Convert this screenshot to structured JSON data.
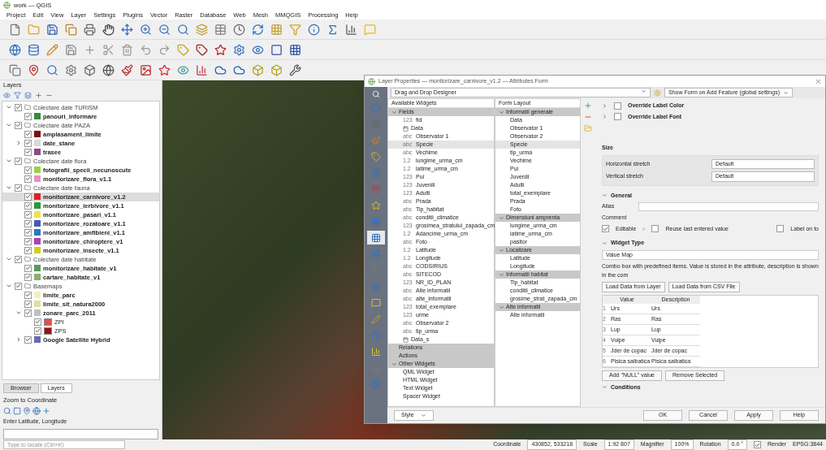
{
  "window": {
    "title": "work — QGIS"
  },
  "menu": [
    "Project",
    "Edit",
    "View",
    "Layer",
    "Settings",
    "Plugins",
    "Vector",
    "Raster",
    "Database",
    "Web",
    "Mesh",
    "MMQGIS",
    "Processing",
    "Help"
  ],
  "layers_panel": {
    "title": "Layers",
    "items": [
      {
        "kind": "group",
        "label": "Colectare date TURISM",
        "checked": true,
        "expanded": true,
        "children": [
          {
            "kind": "layer",
            "label": "panouri_informare",
            "checked": true,
            "color": "#3a8a3a"
          }
        ]
      },
      {
        "kind": "group",
        "label": "Colectare date PAZA",
        "checked": true,
        "expanded": true,
        "children": [
          {
            "kind": "layer",
            "label": "amplasament_limite",
            "checked": true,
            "color": "#7a1010"
          },
          {
            "kind": "layer",
            "label": "date_stane",
            "checked": true,
            "expanded": false,
            "color": "#d8d8d8"
          },
          {
            "kind": "layer",
            "label": "trasee",
            "checked": true,
            "color": "#8a4a8a"
          }
        ]
      },
      {
        "kind": "group",
        "label": "Colectare date flora",
        "checked": true,
        "expanded": true,
        "children": [
          {
            "kind": "layer",
            "label": "fotografii_specii_necunoscute",
            "checked": true,
            "color": "#9ad04a"
          },
          {
            "kind": "layer",
            "label": "monitorizare_flora_v1.1",
            "checked": true,
            "color": "#e890c8"
          }
        ]
      },
      {
        "kind": "group",
        "label": "Colectare date fauna",
        "checked": true,
        "expanded": true,
        "children": [
          {
            "kind": "layer",
            "label": "monitorizare_carnivore_v1.2",
            "checked": true,
            "selected": true,
            "color": "#e02020"
          },
          {
            "kind": "layer",
            "label": "monitorizare_ierbivore_v1.1",
            "checked": true,
            "color": "#2a9a3a"
          },
          {
            "kind": "layer",
            "label": "monitorizare_pasari_v1.1",
            "checked": true,
            "color": "#f0e050"
          },
          {
            "kind": "layer",
            "label": "monitorizare_rozatoare_v1.1",
            "checked": true,
            "color": "#4a5ab0"
          },
          {
            "kind": "layer",
            "label": "monitorizare_amfibieni_v1.1",
            "checked": true,
            "color": "#2a7ac0"
          },
          {
            "kind": "layer",
            "label": "monitorizare_chiroptere_v1",
            "checked": true,
            "color": "#b040b0"
          },
          {
            "kind": "layer",
            "label": "monitorizare_insecte_v1.1",
            "checked": true,
            "color": "#d0d020"
          }
        ]
      },
      {
        "kind": "group",
        "label": "Colectare date habitate",
        "checked": true,
        "expanded": true,
        "children": [
          {
            "kind": "layer",
            "label": "monitorizare_habitate_v1",
            "checked": true,
            "color": "#5a9a5a"
          },
          {
            "kind": "layer",
            "label": "cartare_habitate_v1",
            "checked": true,
            "color": "#8ab070"
          }
        ]
      },
      {
        "kind": "group",
        "label": "Basemaps",
        "checked": true,
        "expanded": true,
        "children": [
          {
            "kind": "layer",
            "label": "limite_parc",
            "checked": true,
            "color": "#f0f0c0"
          },
          {
            "kind": "layer",
            "label": "limite_sit_natura2000",
            "checked": true,
            "color": "#e0e0a0"
          },
          {
            "kind": "layer",
            "label": "zonare_parc_2011",
            "checked": true,
            "expanded": true,
            "color": "#c0c0c0",
            "children": [
              {
                "kind": "class",
                "label": "ZPI",
                "checked": true,
                "color": "#e05050"
              },
              {
                "kind": "class",
                "label": "ZPS",
                "checked": true,
                "color": "#a01010"
              }
            ]
          },
          {
            "kind": "layer",
            "label": "Google Satellite Hybrid",
            "checked": true,
            "expanded": false,
            "color": "#6a6ab0"
          }
        ]
      }
    ]
  },
  "bottom_tabs": [
    {
      "label": "Browser",
      "selected": false
    },
    {
      "label": "Layers",
      "selected": true
    }
  ],
  "zoom_panel": {
    "title": "Zoom to Coordinate",
    "prompt": "Enter Latitude, Longitude"
  },
  "dialog": {
    "title": "Layer Properties — monitorizare_carnivore_v1.2 — Attributes Form",
    "mode": "Drag and Drop Designer",
    "form_option": "Show Form on Add Feature (global settings)",
    "available": {
      "title": "Available Widgets",
      "groups": [
        {
          "label": "Fields",
          "expanded": true,
          "items": [
            {
              "kind": "field",
              "type": "123",
              "name": "fid",
              "selected": false
            },
            {
              "kind": "date",
              "name": "Data",
              "selected": false
            },
            {
              "kind": "field",
              "type": "abc",
              "name": "Observator 1",
              "selected": false
            },
            {
              "kind": "field",
              "type": "abc",
              "name": "Specie",
              "selected": true
            },
            {
              "kind": "field",
              "type": "abc",
              "name": "Vechime",
              "selected": false
            },
            {
              "kind": "field",
              "type": "1.2",
              "name": "lungime_urma_cm",
              "selected": false
            },
            {
              "kind": "field",
              "type": "1.2",
              "name": "latime_urma_cm",
              "selected": false
            },
            {
              "kind": "field",
              "type": "123",
              "name": "Pui",
              "selected": false
            },
            {
              "kind": "field",
              "type": "123",
              "name": "Juvenili",
              "selected": false
            },
            {
              "kind": "field",
              "type": "123",
              "name": "Adulti",
              "selected": false
            },
            {
              "kind": "field",
              "type": "abc",
              "name": "Prada",
              "selected": false
            },
            {
              "kind": "field",
              "type": "abc",
              "name": "Tip_habitat",
              "selected": false
            },
            {
              "kind": "field",
              "type": "abc",
              "name": "conditii_climatice",
              "selected": false
            },
            {
              "kind": "field",
              "type": "123",
              "name": "grosimea_stratului_zapada_cm",
              "selected": false
            },
            {
              "kind": "field",
              "type": "1.2",
              "name": "Adancime_urma_cm",
              "selected": false
            },
            {
              "kind": "field",
              "type": "abc",
              "name": "Foto",
              "selected": false
            },
            {
              "kind": "field",
              "type": "1.2",
              "name": "Latitude",
              "selected": false
            },
            {
              "kind": "field",
              "type": "1.2",
              "name": "Longitude",
              "selected": false
            },
            {
              "kind": "field",
              "type": "abc",
              "name": "CODSIRIUS",
              "selected": false
            },
            {
              "kind": "field",
              "type": "abc",
              "name": "SITECOD",
              "selected": false
            },
            {
              "kind": "field",
              "type": "123",
              "name": "NR_ID_PLAN",
              "selected": false
            },
            {
              "kind": "field",
              "type": "abc",
              "name": "Alte informatii",
              "selected": false
            },
            {
              "kind": "field",
              "type": "abc",
              "name": "alte_informatii",
              "selected": false
            },
            {
              "kind": "field",
              "type": "123",
              "name": "total_exemplare",
              "selected": false
            },
            {
              "kind": "field",
              "type": "123",
              "name": "urme",
              "selected": false
            },
            {
              "kind": "field",
              "type": "abc",
              "name": "Observator 2",
              "selected": false
            },
            {
              "kind": "field",
              "type": "abc",
              "name": "tip_urma",
              "selected": false
            },
            {
              "kind": "date",
              "name": "Data_s",
              "selected": false
            }
          ]
        },
        {
          "label": "Relations"
        },
        {
          "label": "Actions"
        },
        {
          "label": "Other Widgets",
          "expanded": true,
          "items": [
            {
              "kind": "other",
              "name": "QML Widget",
              "selected": false
            },
            {
              "kind": "other",
              "name": "HTML Widget",
              "selected": false
            },
            {
              "kind": "other",
              "name": "Text Widget",
              "selected": false
            },
            {
              "kind": "other",
              "name": "Spacer Widget",
              "selected": false
            }
          ]
        }
      ]
    },
    "layout": {
      "title": "Form Layout",
      "groups": [
        {
          "label": "Informatii generale",
          "items": [
            {
              "name": "Data",
              "selected": false
            },
            {
              "name": "Observator 1",
              "selected": false
            },
            {
              "name": "Observator 2",
              "selected": false
            },
            {
              "name": "Specie",
              "selected": true
            },
            {
              "name": "tip_urma",
              "selected": false
            },
            {
              "name": "Vechime",
              "selected": false
            },
            {
              "name": "Pui",
              "selected": false
            },
            {
              "name": "Juvenili",
              "selected": false
            },
            {
              "name": "Adulti",
              "selected": false
            },
            {
              "name": "total_exemplare",
              "selected": false
            },
            {
              "name": "Prada",
              "selected": false
            },
            {
              "name": "Foto",
              "selected": false
            }
          ]
        },
        {
          "label": "Dimensiuni amprenta",
          "items": [
            {
              "name": "lungime_urma_cm",
              "selected": false
            },
            {
              "name": "latime_urma_cm",
              "selected": false
            },
            {
              "name": "pasitor",
              "selected": false
            }
          ]
        },
        {
          "label": "Localizare",
          "items": [
            {
              "name": "Latitude",
              "selected": false
            },
            {
              "name": "Longitude",
              "selected": false
            }
          ]
        },
        {
          "label": "Informatii habitat",
          "items": [
            {
              "name": "Tip_habitat",
              "selected": false
            },
            {
              "name": "conditii_climatice",
              "selected": false
            },
            {
              "name": "grosime_strat_zapada_cm",
              "selected": false
            }
          ]
        },
        {
          "label": "Alte informatii",
          "items": [
            {
              "name": "Alte informatii",
              "selected": false
            }
          ]
        }
      ]
    },
    "config": {
      "overrides": [
        {
          "label": "Override Label Color",
          "checked": false
        },
        {
          "label": "Override Label Font",
          "checked": false
        }
      ],
      "size": {
        "title": "Size",
        "rows": [
          {
            "label": "Horizontal stretch",
            "value": "Default"
          },
          {
            "label": "Vertical stretch",
            "value": "Default"
          }
        ]
      },
      "general": {
        "title": "General",
        "alias_label": "Alias",
        "comment_label": "Comment",
        "options": [
          {
            "label": "Editable",
            "checked": true
          },
          {
            "label": "Reuse last entered value",
            "checked": false
          },
          {
            "label": "Label on to",
            "checked": false
          }
        ]
      },
      "widget_type": {
        "title": "Widget Type",
        "value": "Value Map",
        "description": "Combo box with predefined items. Value is stored in the attribute, description is shown in the com",
        "load_buttons": [
          "Load Data from Layer",
          "Load Data from CSV File"
        ],
        "columns": [
          "Value",
          "Description"
        ],
        "rows": [
          {
            "index": "1",
            "value": "Urs",
            "description": "Urs"
          },
          {
            "index": "2",
            "value": "Ras",
            "description": "Ras"
          },
          {
            "index": "3",
            "value": "Lup",
            "description": "Lup"
          },
          {
            "index": "4",
            "value": "Vulpe",
            "description": "Vulpe"
          },
          {
            "index": "5",
            "value": "Jder de copac",
            "description": "Jder de copac"
          },
          {
            "index": "6",
            "value": "Pisica salbatica",
            "description": "Pisica salbatica"
          }
        ],
        "table_buttons": [
          "Add \"NULL\" value",
          "Remove Selected"
        ]
      },
      "conditions_title": "Conditions"
    },
    "style_button": "Style",
    "buttons": [
      "OK",
      "Cancel",
      "Apply",
      "Help"
    ]
  },
  "status_bar": {
    "search_placeholder": "Type to locate (Ctrl+K)",
    "coordinate_label": "Coordinate",
    "coordinate": "430852, 533218",
    "scale_label": "Scale",
    "scale": "1:92 807",
    "magnifier_label": "Magnifier",
    "magnifier": "100%",
    "rotation_label": "Rotation",
    "rotation": "0.0 °",
    "render_label": "Render",
    "render": true,
    "crs": "EPSG:3844"
  }
}
